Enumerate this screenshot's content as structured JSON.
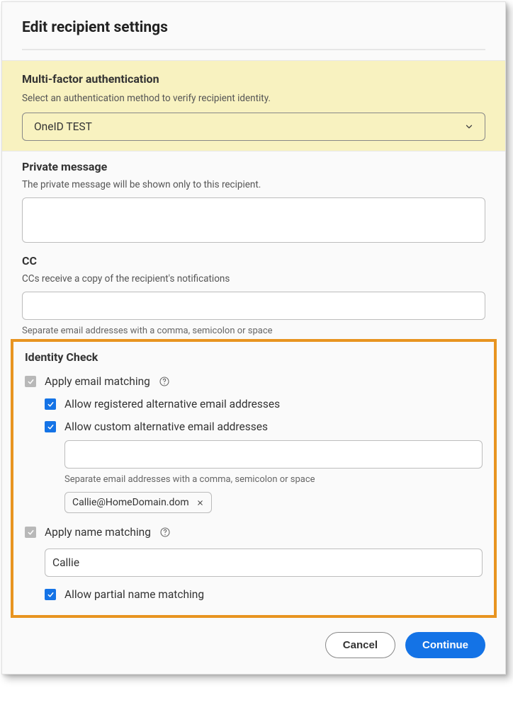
{
  "header": {
    "title": "Edit recipient settings"
  },
  "mfa": {
    "title": "Multi-factor authentication",
    "desc": "Select an authentication method to verify recipient identity.",
    "selected": "OneID TEST"
  },
  "privateMessage": {
    "title": "Private message",
    "desc": "The private message will be shown only to this recipient."
  },
  "cc": {
    "title": "CC",
    "desc": "CCs receive a copy of the recipient's notifications",
    "hint": "Separate email addresses with a comma, semicolon or space"
  },
  "identity": {
    "title": "Identity Check",
    "emailMatching": "Apply email matching",
    "allowRegistered": "Allow registered alternative email addresses",
    "allowCustom": "Allow custom alternative email addresses",
    "customHint": "Separate email addresses with a comma, semicolon or space",
    "customChip": "Callie@HomeDomain.dom",
    "nameMatching": "Apply name matching",
    "nameValue": "Callie",
    "allowPartial": "Allow partial name matching"
  },
  "footer": {
    "cancel": "Cancel",
    "continue": "Continue"
  }
}
